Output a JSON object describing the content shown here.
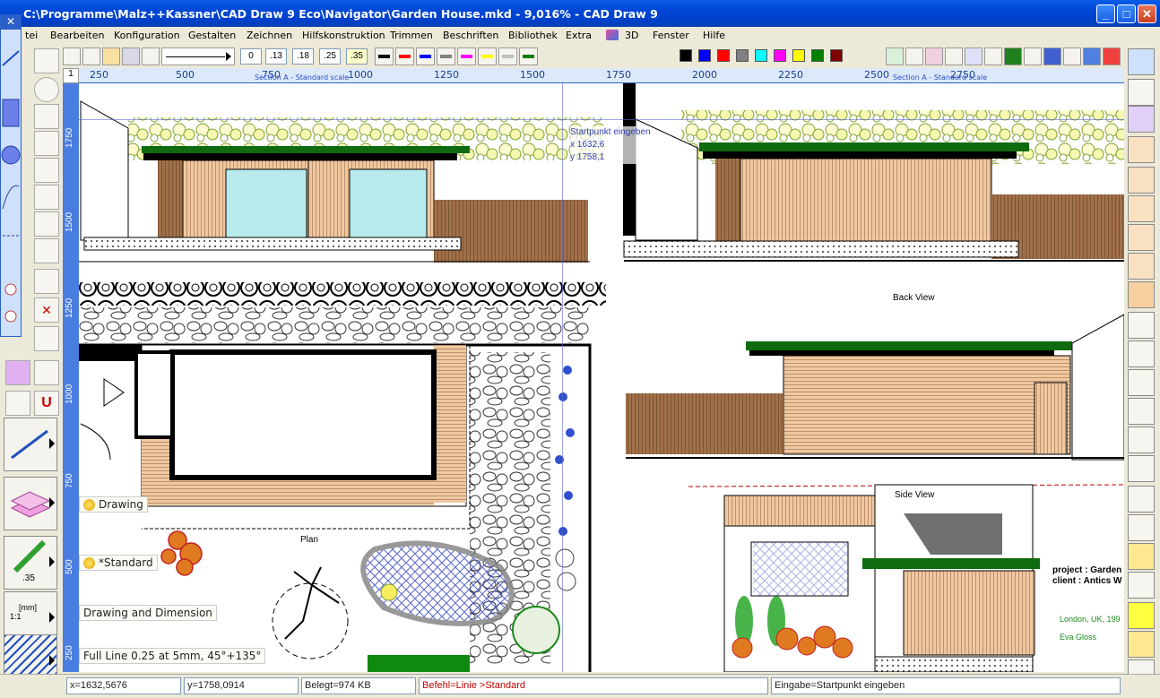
{
  "window": {
    "title": "C:\\Programme\\Malz++Kassner\\CAD Draw 9 Eco\\Navigator\\Garden House.mkd - 9,016% - CAD Draw 9",
    "controls": [
      "_",
      "□",
      "✕"
    ]
  },
  "menu": [
    "tei",
    "Bearbeiten",
    "Konfiguration",
    "Gestalten",
    "Zeichnen",
    "Hilfskonstruktion",
    "Trimmen",
    "Beschriften",
    "Bibliothek",
    "Extra",
    "3D",
    "Fenster",
    "Hilfe"
  ],
  "toolbar": {
    "line_widths": [
      "0",
      ".13",
      ".18",
      ".25",
      ".35"
    ],
    "line_colors": [
      "#000000",
      "#ff0000",
      "#0000ff",
      "#808080",
      "#ff00ff",
      "#ffff00",
      "#c0c0c0",
      "#008000"
    ],
    "fill_colors": [
      "#000000",
      "#0000ff",
      "#ff0000",
      "#808080",
      "#00ffff",
      "#ff00ff",
      "#ffff00",
      "#008000",
      "#800000"
    ]
  },
  "ruler": {
    "corner": "1",
    "h_ticks": [
      "250",
      "500",
      "750",
      "1000",
      "1250",
      "1500",
      "1750",
      "2000",
      "2250",
      "2500",
      "2750"
    ],
    "v_ticks": [
      "1750",
      "1500",
      "1250",
      "1000",
      "750",
      "500",
      "250"
    ],
    "section_a": "Section A - Standard scale",
    "section_b": "Section A - Standard scale"
  },
  "cursor": {
    "prompt": "Startpunkt eingeben",
    "x": "x  1632,6",
    "y": "y  1758,1"
  },
  "layers": {
    "drawing": "Drawing",
    "standard": "*Standard",
    "dim": "Drawing and Dimension",
    "line": "Full Line 0.25 at 5mm, 45°+135°"
  },
  "labels": {
    "back_view": "Back View",
    "side_view": "Side View",
    "plan": "Plan",
    "project": "project : Garden",
    "client": "client :   Antics W",
    "location": "London, UK, 199",
    "author": "Eva Gloss"
  },
  "tools": {
    "scale_text": "[mm]\n1:1",
    "line_width_badge": ".35"
  },
  "status": {
    "x": "x=1632,5676",
    "y": "y=1758,0914",
    "memory": "Belegt=974 KB",
    "command": "Befehl=Linie >Standard",
    "input": "Eingabe=Startpunkt eingeben"
  }
}
